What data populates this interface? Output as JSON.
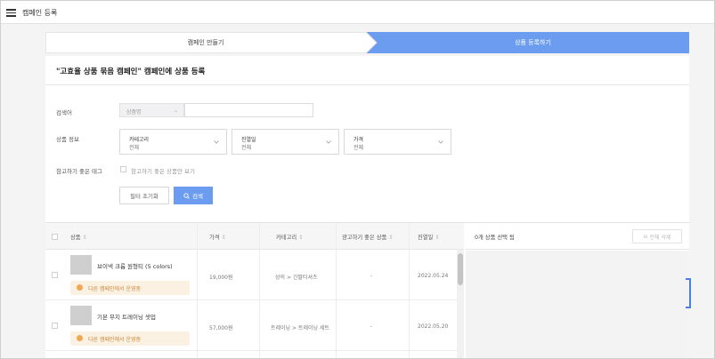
{
  "header": {
    "title": "캠페인 등록",
    "menu_icon": "hamburger-menu-icon"
  },
  "stepper": {
    "steps": [
      {
        "label": "캠페인 만들기",
        "active": false
      },
      {
        "label": "상품 등록하기",
        "active": true
      }
    ],
    "active_color": "#6b9cf0"
  },
  "page": {
    "title": "\"고효율 상품 묶음 캠페인\" 캠페인에 상품 등록"
  },
  "search": {
    "label": "검색어",
    "type_value": "상품명",
    "input_value": ""
  },
  "product_info": {
    "label": "상품 정보",
    "filters": [
      {
        "label": "카테고리",
        "value": "전체"
      },
      {
        "label": "진열일",
        "value": "전체"
      },
      {
        "label": "가격",
        "value": "전체"
      }
    ]
  },
  "only_unregistered": {
    "label": "참고하기 좋은 태그",
    "checkbox_label": "참고하기 좋은 상품만 보기",
    "checked": false
  },
  "buttons": {
    "reset": "필터 초기화",
    "search": "검색"
  },
  "table": {
    "columns": [
      "상품",
      "가격",
      "카테고리",
      "광고하기 좋은 상품",
      "진열일"
    ],
    "rows": [
      {
        "name": "브이넥 크롭 원형티 (5 colors)",
        "tag": "다른 캠페인에서 운영중",
        "price": "19,000원",
        "category": "상의 > 긴팔티셔츠",
        "recommended": "-",
        "date": "2022.05.24"
      },
      {
        "name": "기본 무지 트레이닝 셋업",
        "tag": "다른 캠페인에서 운영중",
        "price": "57,000원",
        "category": "트레이닝 > 트레이닝 세트",
        "recommended": "-",
        "date": "2022.05.20"
      }
    ]
  },
  "selected_panel": {
    "title": "0개 상품 선택 됨",
    "clear_button": "전체 삭제"
  }
}
